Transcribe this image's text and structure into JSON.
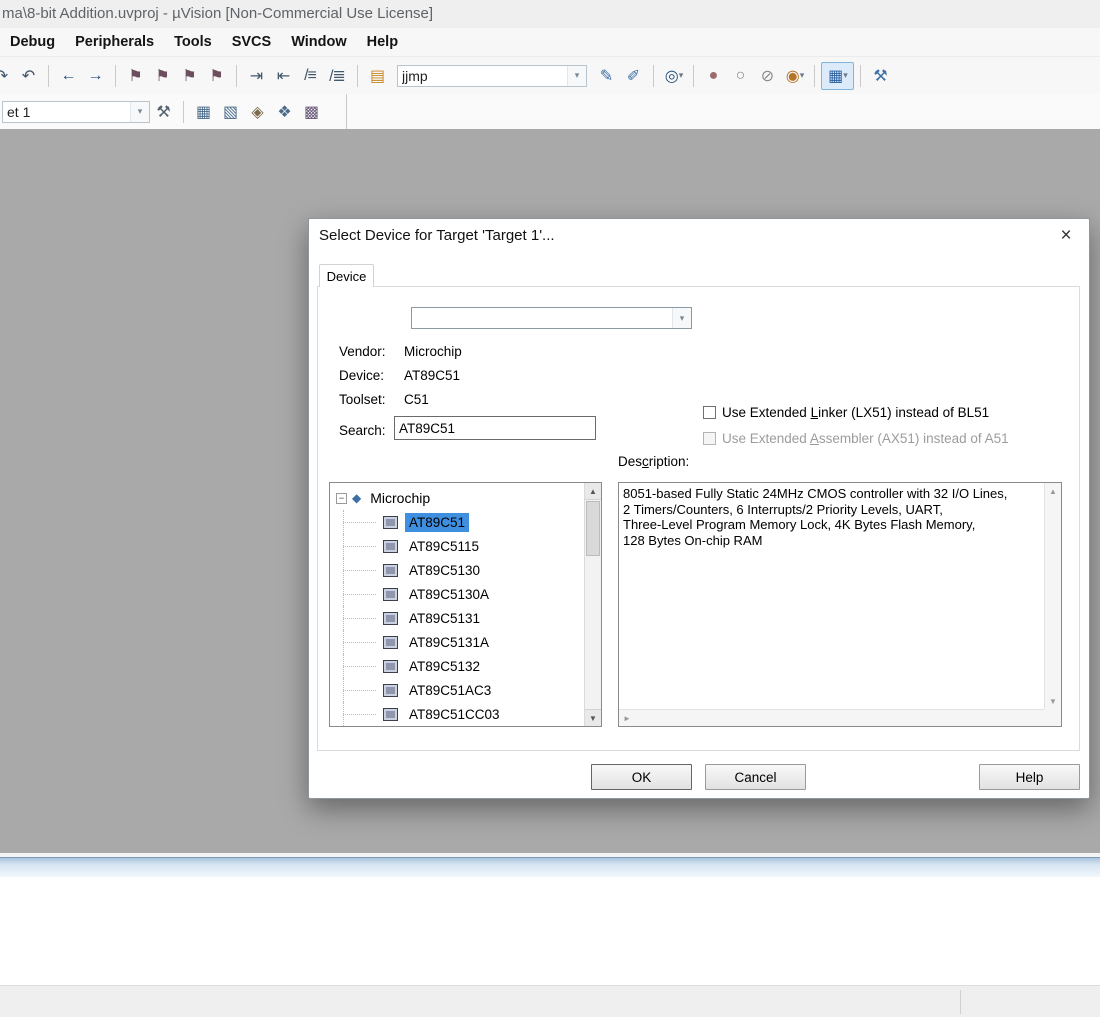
{
  "glyphs": {
    "dropdown": "▾",
    "close": "×",
    "scroll_up": "▲",
    "scroll_down": "▼",
    "scroll_left": "◄",
    "scroll_right": "►",
    "expand_minus": "−",
    "root_diamond": "◆"
  },
  "titlebar": {
    "title": "ma\\8-bit Addition.uvproj - µVision  [Non-Commercial Use License]"
  },
  "menubar": {
    "items": [
      {
        "label": "Debug",
        "name": "menu-debug"
      },
      {
        "label": "Peripherals",
        "name": "menu-peripherals"
      },
      {
        "label": "Tools",
        "name": "menu-tools"
      },
      {
        "label": "SVCS",
        "name": "menu-svcs"
      },
      {
        "label": "Window",
        "name": "menu-window"
      },
      {
        "label": "Help",
        "name": "menu-help"
      }
    ]
  },
  "toolbar_main": {
    "search_value": "jjmp",
    "icons_left": [
      {
        "name": "redo-icon",
        "glyph": "↷",
        "color": "#44566a"
      },
      {
        "name": "undo-icon",
        "glyph": "↶",
        "color": "#44566a"
      },
      {
        "sep": true
      },
      {
        "name": "back-icon",
        "glyph": "←",
        "color": "#1f4e79"
      },
      {
        "name": "forward-icon",
        "glyph": "→",
        "color": "#1f4e79"
      },
      {
        "sep": true
      },
      {
        "name": "bookmark-toggle-icon",
        "glyph": "⚑",
        "color": "#6b4f5f"
      },
      {
        "name": "bookmark-next-icon",
        "glyph": "⚑",
        "color": "#6b4f5f"
      },
      {
        "name": "bookmark-previous-icon",
        "glyph": "⚑",
        "color": "#6b4f5f"
      },
      {
        "name": "bookmark-clear-icon",
        "glyph": "⚑",
        "color": "#6b4f5f"
      },
      {
        "sep": true
      },
      {
        "name": "indent-icon",
        "glyph": "⇥",
        "color": "#44566a"
      },
      {
        "name": "outdent-icon",
        "glyph": "⇤",
        "color": "#44566a"
      },
      {
        "name": "comment-icon",
        "glyph": "/≡",
        "color": "#44566a"
      },
      {
        "name": "uncomment-icon",
        "glyph": "/≣",
        "color": "#44566a"
      },
      {
        "sep": true
      },
      {
        "name": "find-in-files-icon",
        "glyph": "▤",
        "color": "#c8861e"
      }
    ],
    "icons_right": [
      {
        "name": "find-text-icon",
        "glyph": "✎",
        "color": "#3a6ea5"
      },
      {
        "name": "incremental-find-icon",
        "glyph": "✐",
        "color": "#3a6ea5"
      },
      {
        "sep": true
      },
      {
        "name": "find-symbol-icon",
        "glyph": "◎",
        "ddglyph": "▾",
        "color": "#1f4e79"
      },
      {
        "sep": true
      },
      {
        "name": "breakpoint-icon",
        "glyph": "●",
        "color": "#9c6b6b"
      },
      {
        "name": "breakpoint-disable-icon",
        "glyph": "○",
        "color": "#8a8a8a"
      },
      {
        "name": "breakpoint-kill-icon",
        "glyph": "⊘",
        "color": "#8a8a8a"
      },
      {
        "name": "breakpoint-enable-all-icon",
        "glyph": "◉",
        "ddglyph": "▾",
        "color": "#b5762a"
      },
      {
        "sep": true
      },
      {
        "name": "window-layout-icon",
        "glyph": "▦",
        "ddglyph": "▾",
        "color": "#2a5d9f",
        "active": true
      },
      {
        "sep": true
      },
      {
        "name": "configure-wrench-icon",
        "glyph": "⚒",
        "color": "#3a6ea5"
      }
    ]
  },
  "toolbar_build": {
    "target_value": "et 1",
    "icons": [
      {
        "name": "build-target-icon",
        "glyph": "⚒",
        "color": "#55606e"
      },
      {
        "sep": true
      },
      {
        "name": "batch-build-icon",
        "glyph": "▦",
        "color": "#4a6a8a"
      },
      {
        "name": "rebuild-icon",
        "glyph": "▧",
        "color": "#4a6a8a"
      },
      {
        "name": "download-icon",
        "glyph": "◈",
        "color": "#7a6a4a"
      },
      {
        "name": "load-application-icon",
        "glyph": "❖",
        "color": "#4a6a8a"
      },
      {
        "name": "manage-rte-icon",
        "glyph": "▩",
        "color": "#6a5a7a"
      }
    ]
  },
  "dialog": {
    "title": "Select Device for Target 'Target 1'...",
    "tab_label": "Device",
    "vendor_label": "Vendor:",
    "vendor_value": "Microchip",
    "device_label": "Device:",
    "device_value": "AT89C51",
    "toolset_label": "Toolset:",
    "toolset_value": "C51",
    "search_label": "Search:",
    "search_value": "AT89C51",
    "linker_checkbox": {
      "pre": "Use Extended ",
      "u": "L",
      "post": "inker (LX51) instead of BL51"
    },
    "assembler_checkbox": {
      "pre": "Use Extended ",
      "u": "A",
      "post": "ssembler (AX51) instead of A51"
    },
    "description_label": {
      "pre": "Des",
      "u": "c",
      "post": "ription:"
    },
    "tree": {
      "root_label": "Microchip",
      "items": [
        {
          "label": "AT89C51",
          "selected": true,
          "name": "device-item-at89c51"
        },
        {
          "label": "AT89C5115",
          "name": "device-item-at89c5115"
        },
        {
          "label": "AT89C5130",
          "name": "device-item-at89c5130"
        },
        {
          "label": "AT89C5130A",
          "name": "device-item-at89c5130a"
        },
        {
          "label": "AT89C5131",
          "name": "device-item-at89c5131"
        },
        {
          "label": "AT89C5131A",
          "name": "device-item-at89c5131a"
        },
        {
          "label": "AT89C5132",
          "name": "device-item-at89c5132"
        },
        {
          "label": "AT89C51AC3",
          "name": "device-item-at89c51ac3"
        },
        {
          "label": "AT89C51CC03",
          "name": "device-item-at89c51cc03"
        }
      ]
    },
    "description_text": "8051-based Fully Static 24MHz CMOS controller with 32  I/O Lines,\n2 Timers/Counters, 6 Interrupts/2 Priority Levels, UART,\nThree-Level Program Memory Lock, 4K Bytes Flash Memory,\n128 Bytes On-chip RAM",
    "ok_label": "OK",
    "cancel_label": "Cancel",
    "help_label": "Help"
  }
}
